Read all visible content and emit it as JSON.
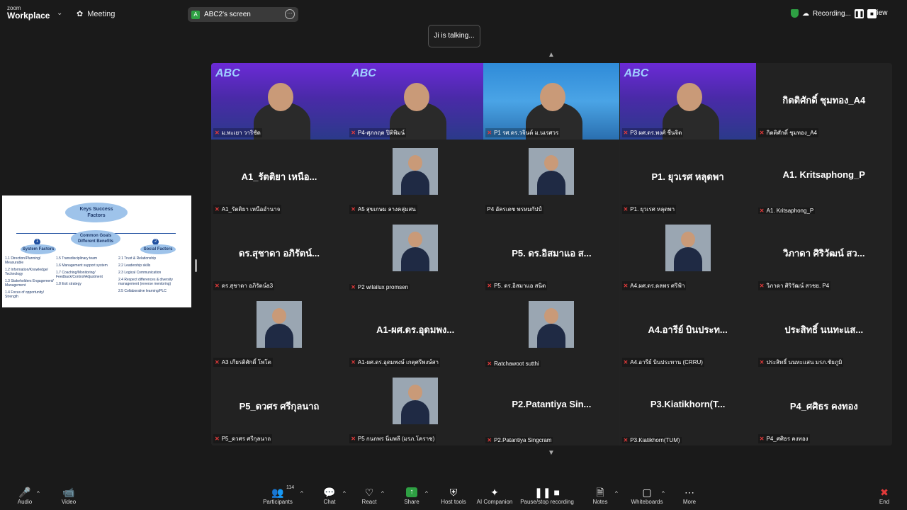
{
  "topbar": {
    "logo_line1": "zoom",
    "logo_line2": "Workplace",
    "meeting_label": "Meeting",
    "share_badge": "A",
    "share_title": "ABC2's screen",
    "recording_label": "Recording...",
    "view_label": "View"
  },
  "talking": "Ji is talking...",
  "tiles": [
    {
      "big": "",
      "label": "ม.พะเยา วาริชัด",
      "muted": true
    },
    {
      "big": "",
      "label": "P4-ศุภกฤต ปิติพิมน์",
      "muted": true
    },
    {
      "big": "",
      "label": "P1 รศ.ดร.วจินต์ ม.นเรศวร",
      "muted": true
    },
    {
      "big": "",
      "label": "P3 ผศ.ดร.พงศ์ ชื่นจิต",
      "muted": true
    },
    {
      "big": "กิตติศักดิ์ ชุมทอง_A4",
      "label": "กิตติศักดิ์ ชุมทอง_A4",
      "muted": true
    },
    {
      "big": "A1_รัตติยา เหนือ...",
      "label": "A1_รัตติยา เหนืออำนาจ",
      "muted": true
    },
    {
      "big": "",
      "label": "A5 สุขเกษม ลางคลุ่มสน",
      "muted": true
    },
    {
      "big": "",
      "label": "P4 อัครเดช พรหมกัปป์",
      "muted": false
    },
    {
      "big": "P1. ยุวเรศ หลุดพา",
      "label": "P1. ยุวเรศ หลุดพา",
      "muted": true
    },
    {
      "big": "A1. Kritsaphong_P",
      "label": "A1. Kritsaphong_P",
      "muted": true
    },
    {
      "big": "ดร.สุชาดา อภิรัตน์...",
      "label": "ดร.สุชาดา อภิรัตน์a3",
      "muted": true
    },
    {
      "big": "",
      "label": "P2 wilailux promsen",
      "muted": true
    },
    {
      "big": "P5. ดร.อิสมาแอ ส...",
      "label": "P5. ดร.อิสมาแอ สนิต",
      "muted": true
    },
    {
      "big": "",
      "label": "A4.ผศ.ดร.ดลพร ศรีฟ้า",
      "muted": true
    },
    {
      "big": "วิภาดา ศิริวัฒน์ สว...",
      "label": "วิภาดา ศิริวัฒน์ สวชย. P4",
      "muted": true
    },
    {
      "big": "",
      "label": "A3 เกียรติศักดิ์ โพโต",
      "muted": true
    },
    {
      "big": "A1-ผศ.ดร.อุดมพง...",
      "label": "A1-ผศ.ดร.อุดมพงษ์ เกตุศรีพงษ์สา",
      "muted": true
    },
    {
      "big": "",
      "label": "Ratchawoot sutthi",
      "muted": true
    },
    {
      "big": "A4.อารีย์ บินประท...",
      "label": "A4.อารีย์ บินประทาน (CRRU)",
      "muted": true
    },
    {
      "big": "ประสิทธิ์ นนทะแส...",
      "label": "ประสิทธิ์ นนทะแสน มรภ.ชัยภูมิ",
      "muted": true
    },
    {
      "big": "P5_ดวศร ศรีกุลนาถ",
      "label": "P5_ดวศร ศรีกุลนาถ",
      "muted": true
    },
    {
      "big": "",
      "label": "P5 กนกพร นิ่มพลี (มรภ.โคราช)",
      "muted": true
    },
    {
      "big": "P2.Patantiya Sin...",
      "label": "P2.Patantiya Singcram",
      "muted": true
    },
    {
      "big": "P3.Kiatikhorn(T...",
      "label": "P3.Kiatikhorn(TUM)",
      "muted": true
    },
    {
      "big": "P4_ศศิธร คงทอง",
      "label": "P4_ศศิธร คงทอง",
      "muted": true
    }
  ],
  "slide": {
    "title_line1": "Keys Success",
    "title_line2": "Factors",
    "center_line1": "Common Goals",
    "center_line2": "Different Benefits",
    "left_num": "1",
    "left_title": "System Factors",
    "right_num": "2",
    "right_title": "Social Factors",
    "col1": [
      "1.1 Direction/Planning/ Measurable",
      "1.2 Information/Knowledge/ Technology",
      "1.3 Stakeholders Engagement/ Management",
      "1.4 Focus of opportunity/ Strength"
    ],
    "col2": [
      "1.5 Transdisciplinary team",
      "1.6 Management support system",
      "1.7 Coaching/Monitoring/ Feedback/Control/Adjustment",
      "1.8 Exit strategy"
    ],
    "col3": [
      "2.1 Trust & Relationship",
      "2.2 Leadership skills",
      "2.3 Logical Communication",
      "2.4 Respect differences & diversity management (reverse mentoring)",
      "2.5 Collaborative learning/PLC"
    ]
  },
  "toolbar": {
    "audio": "Audio",
    "video": "Video",
    "participants": "Participants",
    "participants_count": "114",
    "chat": "Chat",
    "react": "React",
    "share": "Share",
    "host_tools": "Host tools",
    "ai_companion": "AI Companion",
    "pause_recording": "Pause/stop recording",
    "notes": "Notes",
    "whiteboards": "Whiteboards",
    "more": "More",
    "end": "End"
  },
  "colors": {
    "accent_green": "#2ea043",
    "muted_red": "#e23a3a",
    "background": "#1a1a1a"
  }
}
